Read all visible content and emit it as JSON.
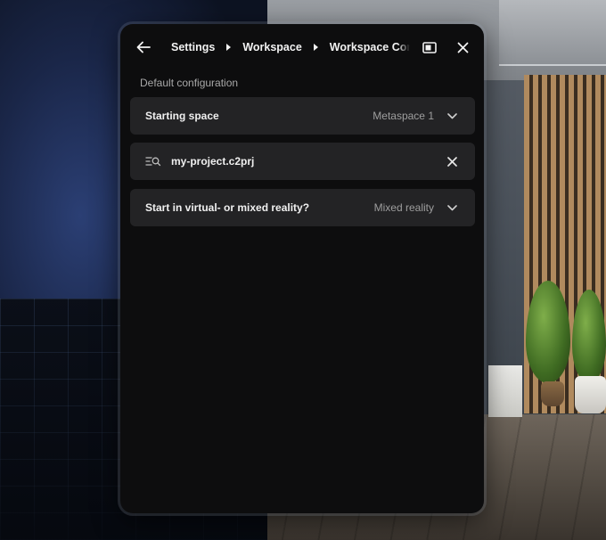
{
  "header": {
    "breadcrumbs": [
      "Settings",
      "Workspace",
      "Workspace Configuration"
    ],
    "back_icon": "arrow-left-icon",
    "window_icon": "window-mode-icon",
    "close_icon": "close-icon"
  },
  "section": {
    "title": "Default configuration"
  },
  "settings": {
    "starting_space": {
      "label": "Starting space",
      "value": "Metaspace 1"
    },
    "project_file": {
      "value": "my-project.c2prj"
    },
    "reality_mode": {
      "label": "Start in virtual- or mixed reality?",
      "value": "Mixed reality"
    }
  },
  "colors": {
    "panel_bg": "#0d0d0e",
    "row_bg": "#232325",
    "text_primary": "#f0f0f0",
    "text_secondary": "#9e9e9e"
  }
}
